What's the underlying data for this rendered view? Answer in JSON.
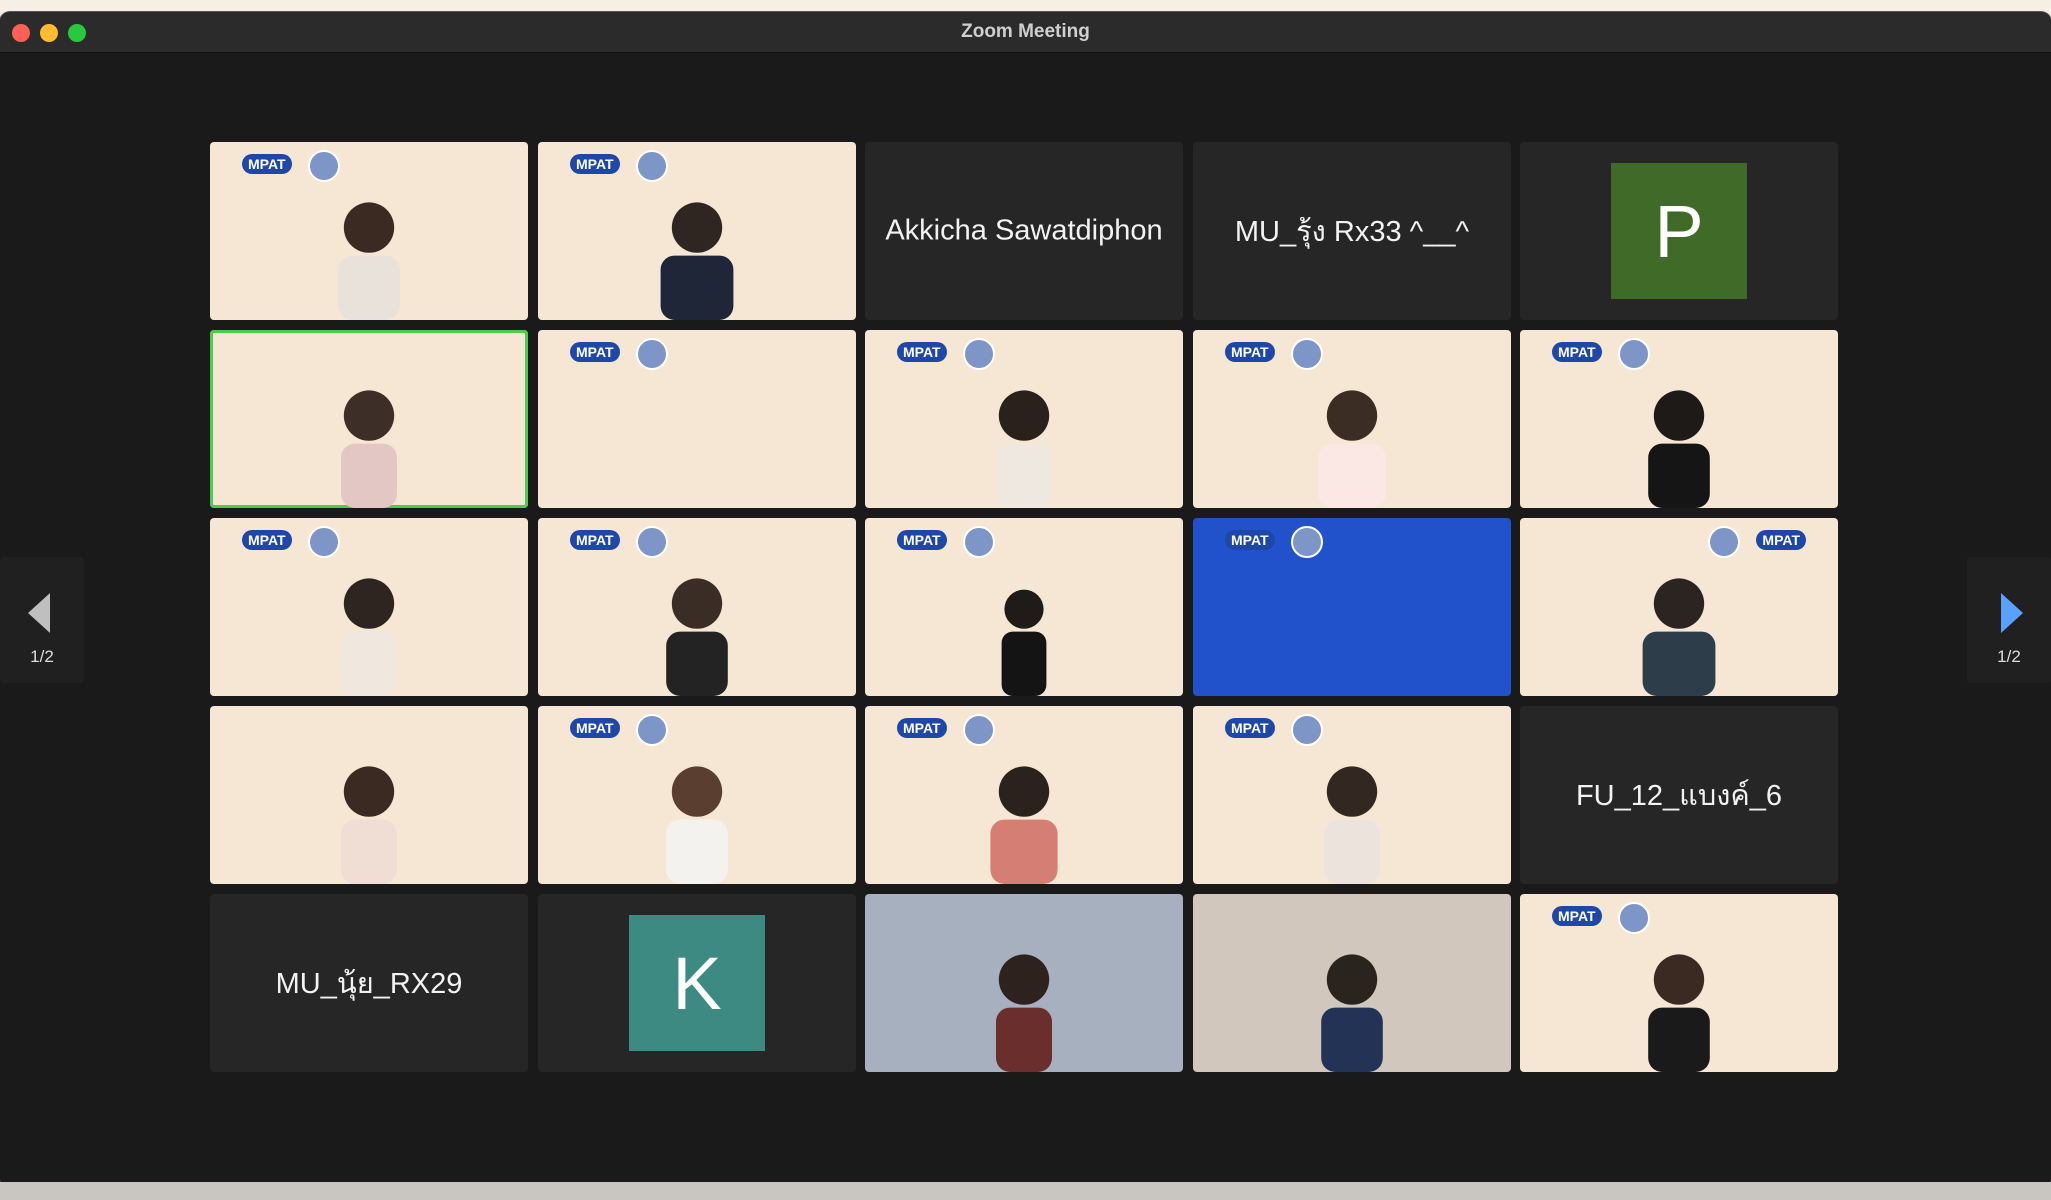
{
  "window": {
    "title": "Zoom Meeting"
  },
  "icons": [
    "close-icon",
    "minimize-icon",
    "maximize-icon",
    "chevron-left-icon",
    "chevron-right-icon"
  ],
  "gallery": {
    "page_indicator_left": "1/2",
    "page_indicator_right": "1/2",
    "tiles": [
      {
        "type": "video",
        "background": "#f6e7d5"
      },
      {
        "type": "video",
        "background": "#f6e7d5"
      },
      {
        "type": "name",
        "label": "Akkicha Sawatdiphon"
      },
      {
        "type": "name",
        "label": "MU_รุ้ง Rx33 ^__^"
      },
      {
        "type": "avatar",
        "letter": "P",
        "color": "#3f6a28"
      },
      {
        "type": "video",
        "active": true,
        "background": "#f6e7d5"
      },
      {
        "type": "video",
        "background": "#f6e7d5"
      },
      {
        "type": "video",
        "background": "#f6e7d5"
      },
      {
        "type": "video",
        "background": "#f6e7d5"
      },
      {
        "type": "video",
        "background": "#f6e7d5"
      },
      {
        "type": "video",
        "background": "#f6e7d5"
      },
      {
        "type": "video",
        "background": "#f6e7d5"
      },
      {
        "type": "video",
        "background": "#f6e7d5"
      },
      {
        "type": "video",
        "background": "#2152cc"
      },
      {
        "type": "video",
        "background": "#f6e7d5"
      },
      {
        "type": "video",
        "background": "#f6e7d5"
      },
      {
        "type": "video",
        "background": "#f6e7d5"
      },
      {
        "type": "video",
        "background": "#f6e7d5"
      },
      {
        "type": "video",
        "background": "#f6e7d5"
      },
      {
        "type": "name",
        "label": "FU_12_แบงค์_6"
      },
      {
        "type": "name",
        "label": "MU_นุ้ย_RX29"
      },
      {
        "type": "avatar",
        "letter": "K",
        "color": "#3d8a83"
      },
      {
        "type": "video",
        "background": "#a7b0bf"
      },
      {
        "type": "video",
        "background": "#d2c7bc"
      },
      {
        "type": "video",
        "background": "#f6e7d5"
      }
    ]
  }
}
